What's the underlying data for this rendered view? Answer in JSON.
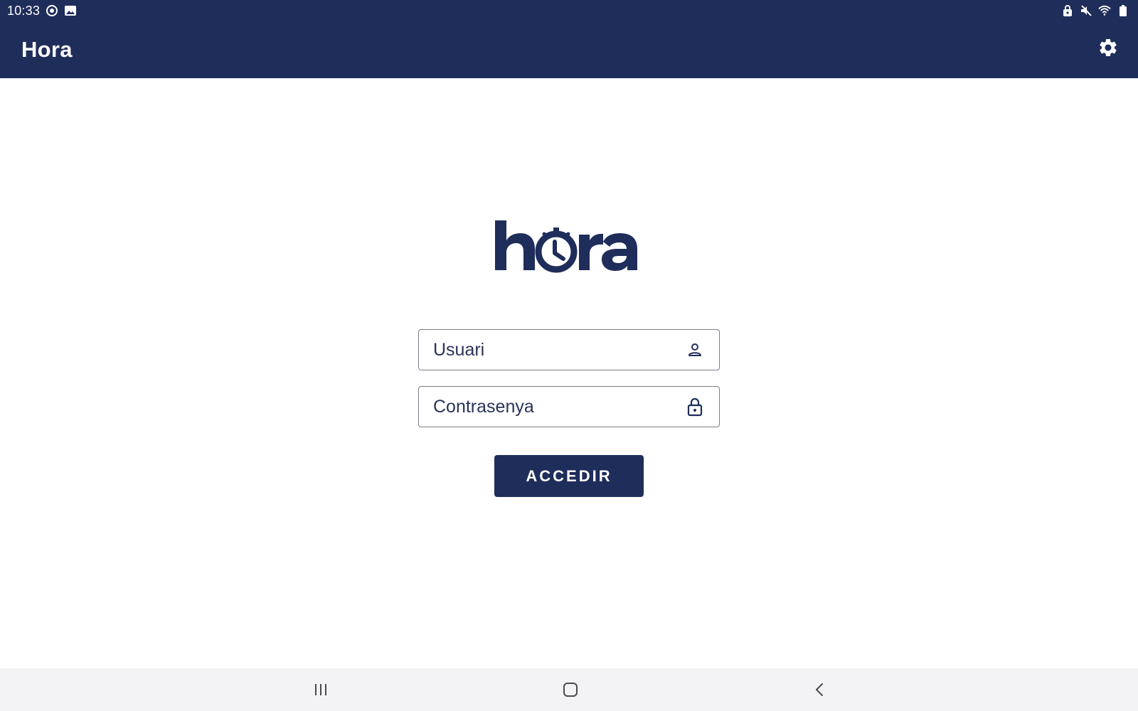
{
  "status_bar": {
    "time": "10:33",
    "left_icons": [
      "sync-icon",
      "gallery-icon"
    ],
    "right_icons": [
      "lock-icon",
      "mute-icon",
      "wifi-icon",
      "battery-icon"
    ]
  },
  "app_bar": {
    "title": "Hora",
    "settings_icon": "gear-icon"
  },
  "logo": {
    "text": "hora",
    "color": "#1f2d5a"
  },
  "form": {
    "username": {
      "value": "",
      "placeholder": "Usuari",
      "icon": "person-icon"
    },
    "password": {
      "value": "",
      "placeholder": "Contrasenya",
      "icon": "lock-icon"
    },
    "submit_label": "ACCEDIR"
  },
  "nav_bar": {
    "items": [
      "recent-apps-icon",
      "home-icon",
      "back-icon"
    ]
  },
  "colors": {
    "primary": "#1f2d5a",
    "background": "#ffffff",
    "nav_bar": "#f3f3f5"
  }
}
